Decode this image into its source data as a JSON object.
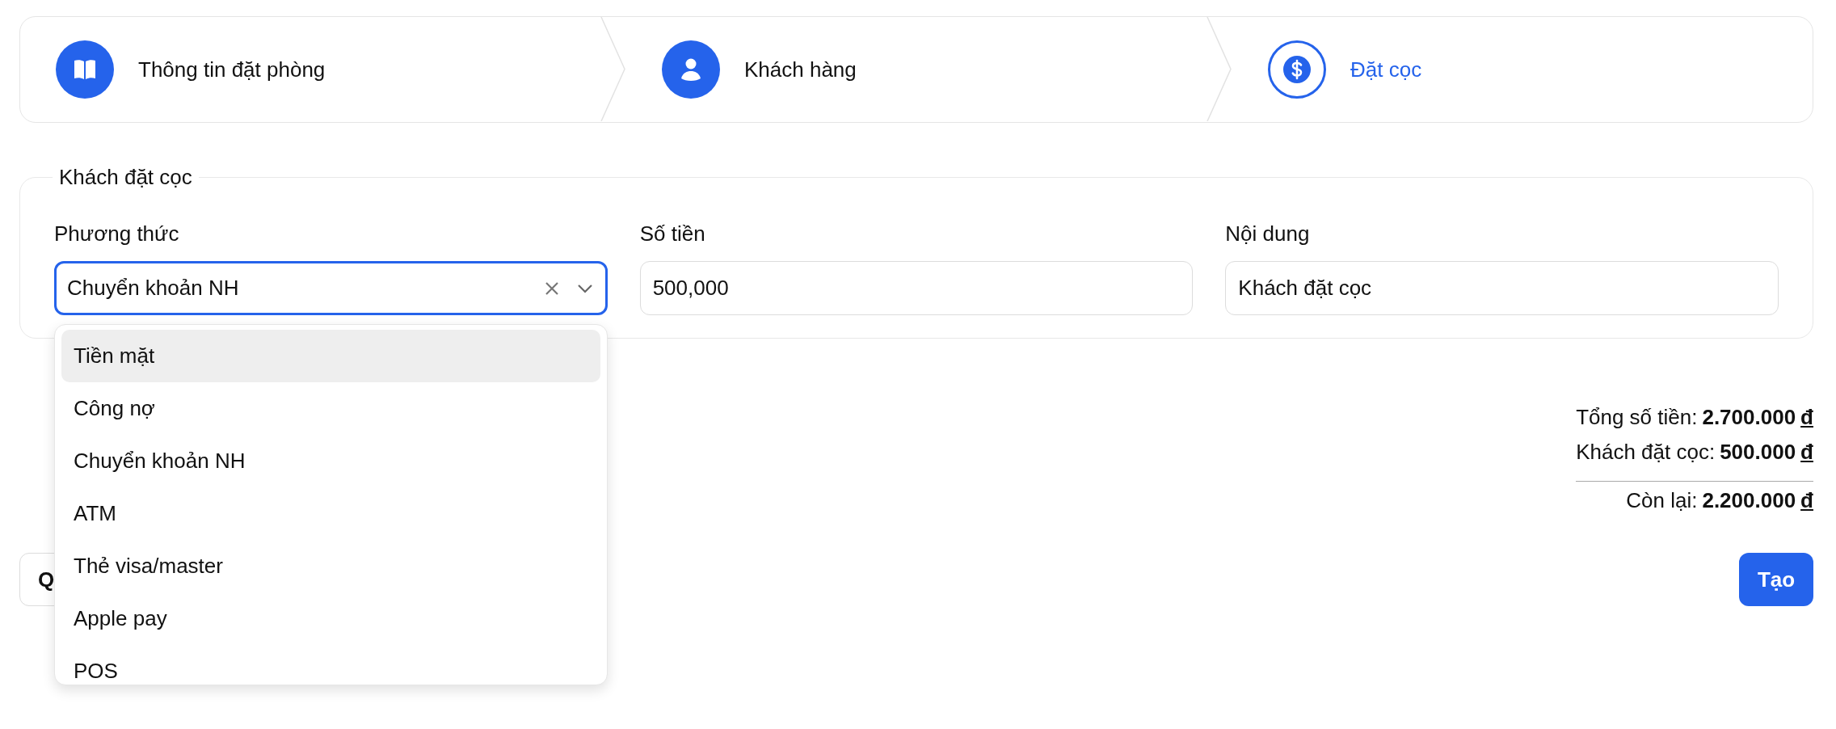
{
  "steps": [
    {
      "label": "Thông tin đặt phòng",
      "selected": false
    },
    {
      "label": "Khách hàng",
      "selected": false
    },
    {
      "label": "Đặt cọc",
      "selected": true
    }
  ],
  "deposit": {
    "legend": "Khách đặt cọc",
    "fields": [
      {
        "kind": "select",
        "label": "Phương thức",
        "value": "Chuyển khoản NH",
        "focused": true
      },
      {
        "kind": "text",
        "label": "Số tiền",
        "value": "500,000",
        "focused": false
      },
      {
        "kind": "text",
        "label": "Nội dung",
        "value": "Khách đặt cọc",
        "focused": false
      }
    ],
    "dropdown": {
      "options": [
        {
          "label": "Tiền mặt",
          "highlighted": true
        },
        {
          "label": "Công nợ",
          "highlighted": false
        },
        {
          "label": "Chuyển khoản NH",
          "highlighted": false
        },
        {
          "label": "ATM",
          "highlighted": false
        },
        {
          "label": "Thẻ visa/master",
          "highlighted": false
        },
        {
          "label": "Apple pay",
          "highlighted": false
        },
        {
          "label": "POS",
          "highlighted": false
        }
      ]
    }
  },
  "totals": [
    {
      "label": "Tổng số tiền:",
      "amount": "2.700.000",
      "currency": "đ"
    },
    {
      "label": "Khách đặt cọc:",
      "amount": "500.000",
      "currency": "đ"
    },
    {
      "label": "Còn lại:",
      "amount": "2.200.000",
      "currency": "đ"
    }
  ],
  "buttons": [
    {
      "label": "Q",
      "kind": "secondary"
    },
    {
      "label": "Tạo",
      "kind": "primary"
    }
  ]
}
